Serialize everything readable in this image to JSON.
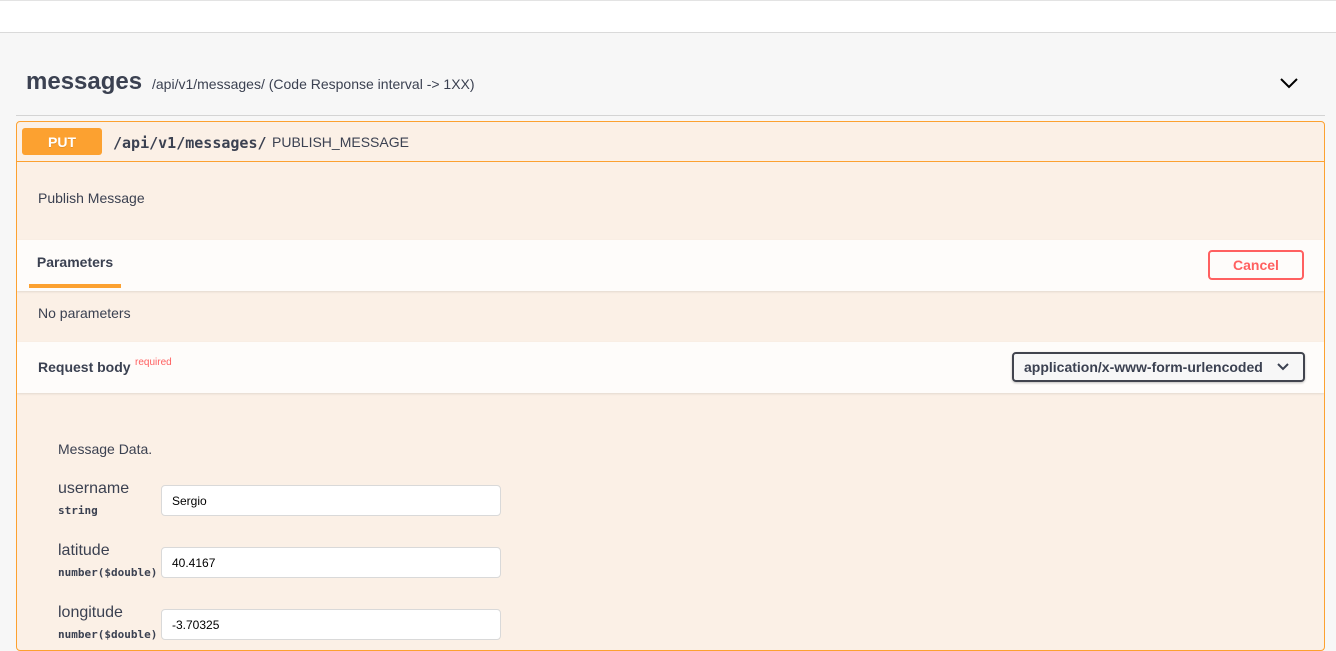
{
  "tag": {
    "name": "messages",
    "description": "/api/v1/messages/ (Code Response interval -> 1XX)"
  },
  "operation": {
    "method": "PUT",
    "path": "/api/v1/messages/",
    "summary": "PUBLISH_MESSAGE",
    "description": "Publish Message"
  },
  "parameters": {
    "tab_label": "Parameters",
    "cancel_label": "Cancel",
    "empty_text": "No parameters"
  },
  "request_body": {
    "title": "Request body",
    "required_label": "required",
    "content_type": "application/x-www-form-urlencoded",
    "form_description": "Message Data."
  },
  "fields": [
    {
      "name": "username",
      "type": "string",
      "value": "Sergio"
    },
    {
      "name": "latitude",
      "type": "number($double)",
      "value": "40.4167"
    },
    {
      "name": "longitude",
      "type": "number($double)",
      "value": "-3.70325"
    }
  ],
  "colors": {
    "put_accent": "#fca130",
    "cancel_red": "#ff6060",
    "panel_bg": "#fbf0e6"
  },
  "icons": {
    "collapse": "chevron-down-icon",
    "select": "chevron-down-icon"
  }
}
